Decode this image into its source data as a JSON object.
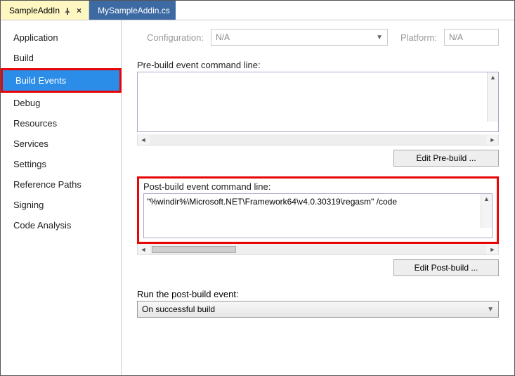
{
  "tabs": {
    "active": "SampleAddIn",
    "inactive": "MySampleAddin.cs"
  },
  "sidebar": {
    "items": [
      "Application",
      "Build",
      "Build Events",
      "Debug",
      "Resources",
      "Services",
      "Settings",
      "Reference Paths",
      "Signing",
      "Code Analysis"
    ],
    "selected_index": 2
  },
  "config": {
    "configuration_label": "Configuration:",
    "configuration_value": "N/A",
    "platform_label": "Platform:",
    "platform_value": "N/A"
  },
  "prebuild": {
    "label": "Pre-build event command line:",
    "value": "",
    "button": "Edit Pre-build ..."
  },
  "postbuild": {
    "label": "Post-build event command line:",
    "value": "\"%windir%\\Microsoft.NET\\Framework64\\v4.0.30319\\regasm\" /code",
    "button": "Edit Post-build ..."
  },
  "run": {
    "label": "Run the post-build event:",
    "value": "On successful build"
  }
}
